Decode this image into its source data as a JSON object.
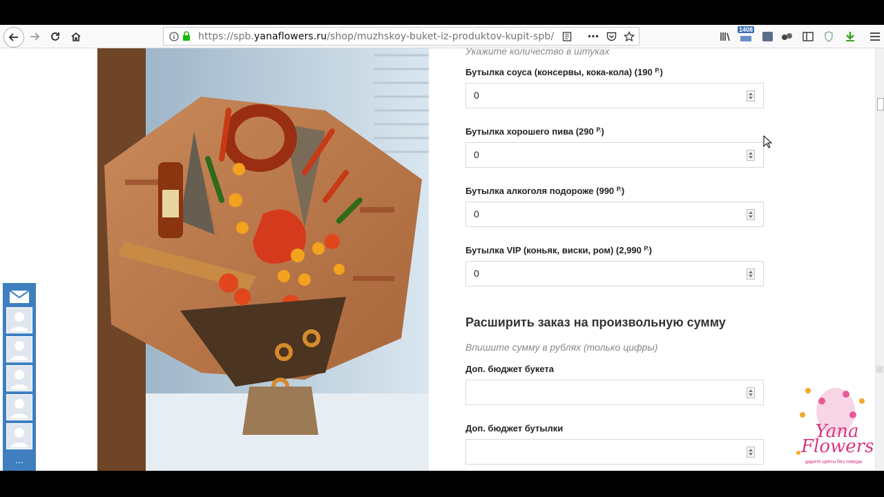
{
  "browser": {
    "url_prefix": "https://spb.",
    "url_domain": "yanaflowers.ru",
    "url_path": "/shop/muzhskoy-buket-iz-produktov-kupit-spb/",
    "library_badge": "1408"
  },
  "form": {
    "quantity_hint": "Укажите количество в штуках",
    "items": [
      {
        "label": "Бутылка соуса (консервы, кока-кола) (190 ",
        "currency": "Р.",
        "close": ")",
        "value": "0"
      },
      {
        "label": "Бутылка хорошего пива (290 ",
        "currency": "Р.",
        "close": ")",
        "value": "0"
      },
      {
        "label": "Бутылка алкоголя подороже (990 ",
        "currency": "Р.",
        "close": ")",
        "value": "0"
      },
      {
        "label": "Бутылка VIP (коньяк, виски, ром) (2,990 ",
        "currency": "Р.",
        "close": ")",
        "value": "0"
      }
    ],
    "extend_title": "Расширить заказ на произвольную сумму",
    "sum_hint": "Впишите сумму в рублях (только цифры)",
    "budget_bouquet_label": "Доп. бюджет букета",
    "budget_bouquet_value": "",
    "budget_bottle_label": "Доп. бюджет бутылки",
    "budget_bottle_value": ""
  },
  "social": {
    "more_label": "..."
  },
  "logo": {
    "line1": "Yana",
    "line2": "Flowers",
    "tagline": "дарите цветы без повода"
  }
}
